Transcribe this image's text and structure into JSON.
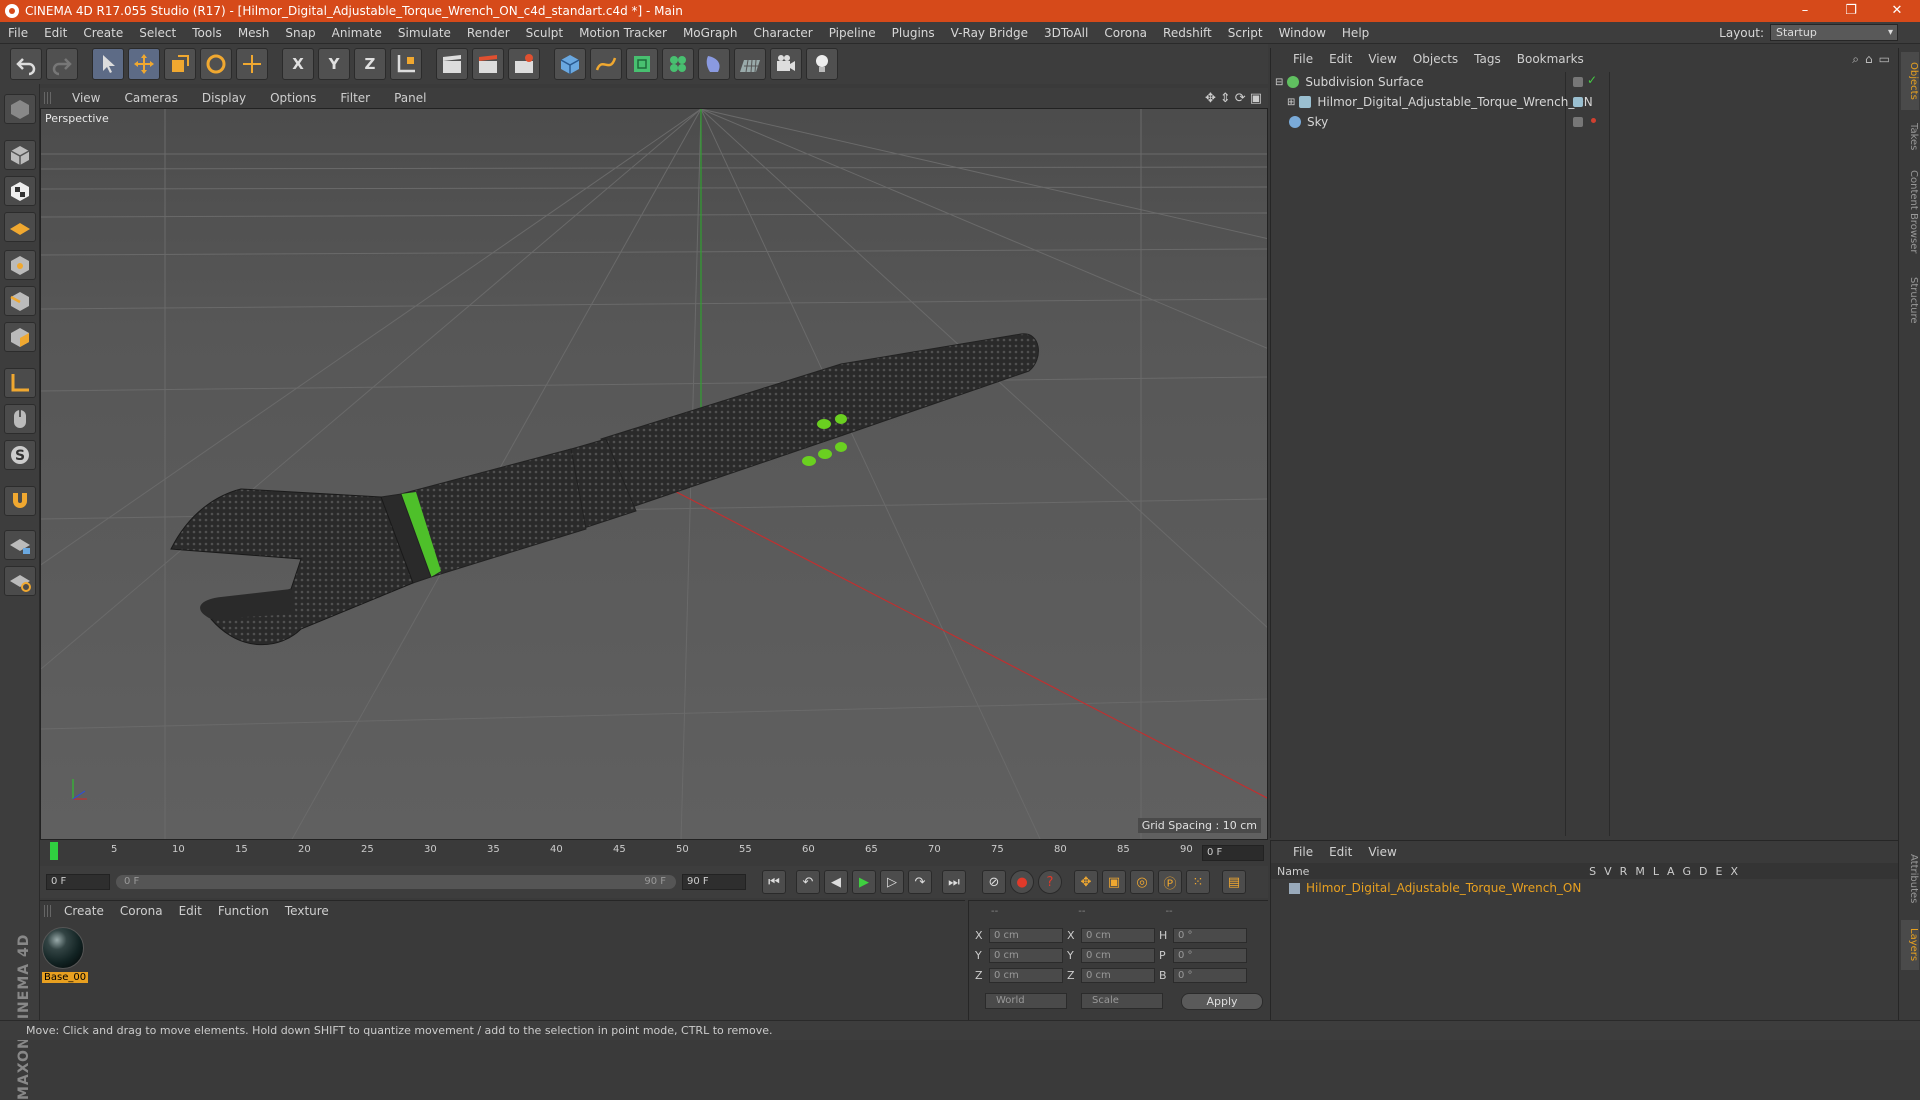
{
  "window": {
    "title": "CINEMA 4D R17.055 Studio (R17) - [Hilmor_Digital_Adjustable_Torque_Wrench_ON_c4d_standart.c4d *] - Main",
    "minimize": "–",
    "maximize": "❐",
    "close": "✕"
  },
  "menu": {
    "items": [
      "File",
      "Edit",
      "Create",
      "Select",
      "Tools",
      "Mesh",
      "Snap",
      "Animate",
      "Simulate",
      "Render",
      "Sculpt",
      "Motion Tracker",
      "MoGraph",
      "Character",
      "Pipeline",
      "Plugins",
      "V-Ray Bridge",
      "3DToAll",
      "Corona",
      "Redshift",
      "Script",
      "Window",
      "Help"
    ],
    "layout_label": "Layout:",
    "layout_value": "Startup"
  },
  "toolbar": {
    "axis_x": "X",
    "axis_y": "Y",
    "axis_z": "Z"
  },
  "viewport": {
    "menu": [
      "View",
      "Cameras",
      "Display",
      "Options",
      "Filter",
      "Panel"
    ],
    "label": "Perspective",
    "grid_spacing": "Grid Spacing : 10 cm"
  },
  "timeline": {
    "ticks": [
      "0",
      "5",
      "10",
      "15",
      "20",
      "25",
      "30",
      "35",
      "40",
      "45",
      "50",
      "55",
      "60",
      "65",
      "70",
      "75",
      "80",
      "85",
      "90"
    ],
    "current_frame": "0 F"
  },
  "playback": {
    "start": "0 F",
    "slider_start": "0 F",
    "slider_end": "90 F",
    "end": "90 F"
  },
  "material_manager": {
    "menu": [
      "Create",
      "Corona",
      "Edit",
      "Function",
      "Texture"
    ],
    "materials": [
      "Base_00"
    ]
  },
  "coordinates": {
    "headers": [
      "--",
      "--",
      "--"
    ],
    "rows": [
      {
        "l1": "X",
        "v1": "0 cm",
        "l2": "X",
        "v2": "0 cm",
        "l3": "H",
        "v3": "0 °"
      },
      {
        "l1": "Y",
        "v1": "0 cm",
        "l2": "Y",
        "v2": "0 cm",
        "l3": "P",
        "v3": "0 °"
      },
      {
        "l1": "Z",
        "v1": "0 cm",
        "l2": "Z",
        "v2": "0 cm",
        "l3": "B",
        "v3": "0 °"
      }
    ],
    "mode_world": "World",
    "mode_scale": "Scale",
    "apply": "Apply"
  },
  "object_manager": {
    "menu": [
      "File",
      "Edit",
      "View",
      "Objects",
      "Tags",
      "Bookmarks"
    ],
    "objects": [
      {
        "name": "Subdivision Surface",
        "color": "#60c060"
      },
      {
        "name": "Hilmor_Digital_Adjustable_Torque_Wrench_ON",
        "color": "#9abfd0"
      },
      {
        "name": "Sky",
        "color": "#7aaad8"
      }
    ]
  },
  "layer_manager": {
    "menu": [
      "File",
      "Edit",
      "View"
    ],
    "name_header": "Name",
    "columns": [
      "S",
      "V",
      "R",
      "M",
      "L",
      "A",
      "G",
      "D",
      "E",
      "X"
    ],
    "layers": [
      "Hilmor_Digital_Adjustable_Torque_Wrench_ON"
    ]
  },
  "side_tabs": [
    "Objects",
    "Takes",
    "Content Browser",
    "Structure",
    "Attributes",
    "Layers"
  ],
  "status": "Move: Click and drag to move elements. Hold down SHIFT to quantize movement / add to the selection in point mode, CTRL to remove.",
  "brand": "MAXON CINEMA 4D",
  "colors": {
    "titlebar": "#d64a1a",
    "accent_orange": "#e8a020",
    "x_axis": "#c03030",
    "y_axis": "#30a030",
    "wrench_green": "#6ad020"
  }
}
